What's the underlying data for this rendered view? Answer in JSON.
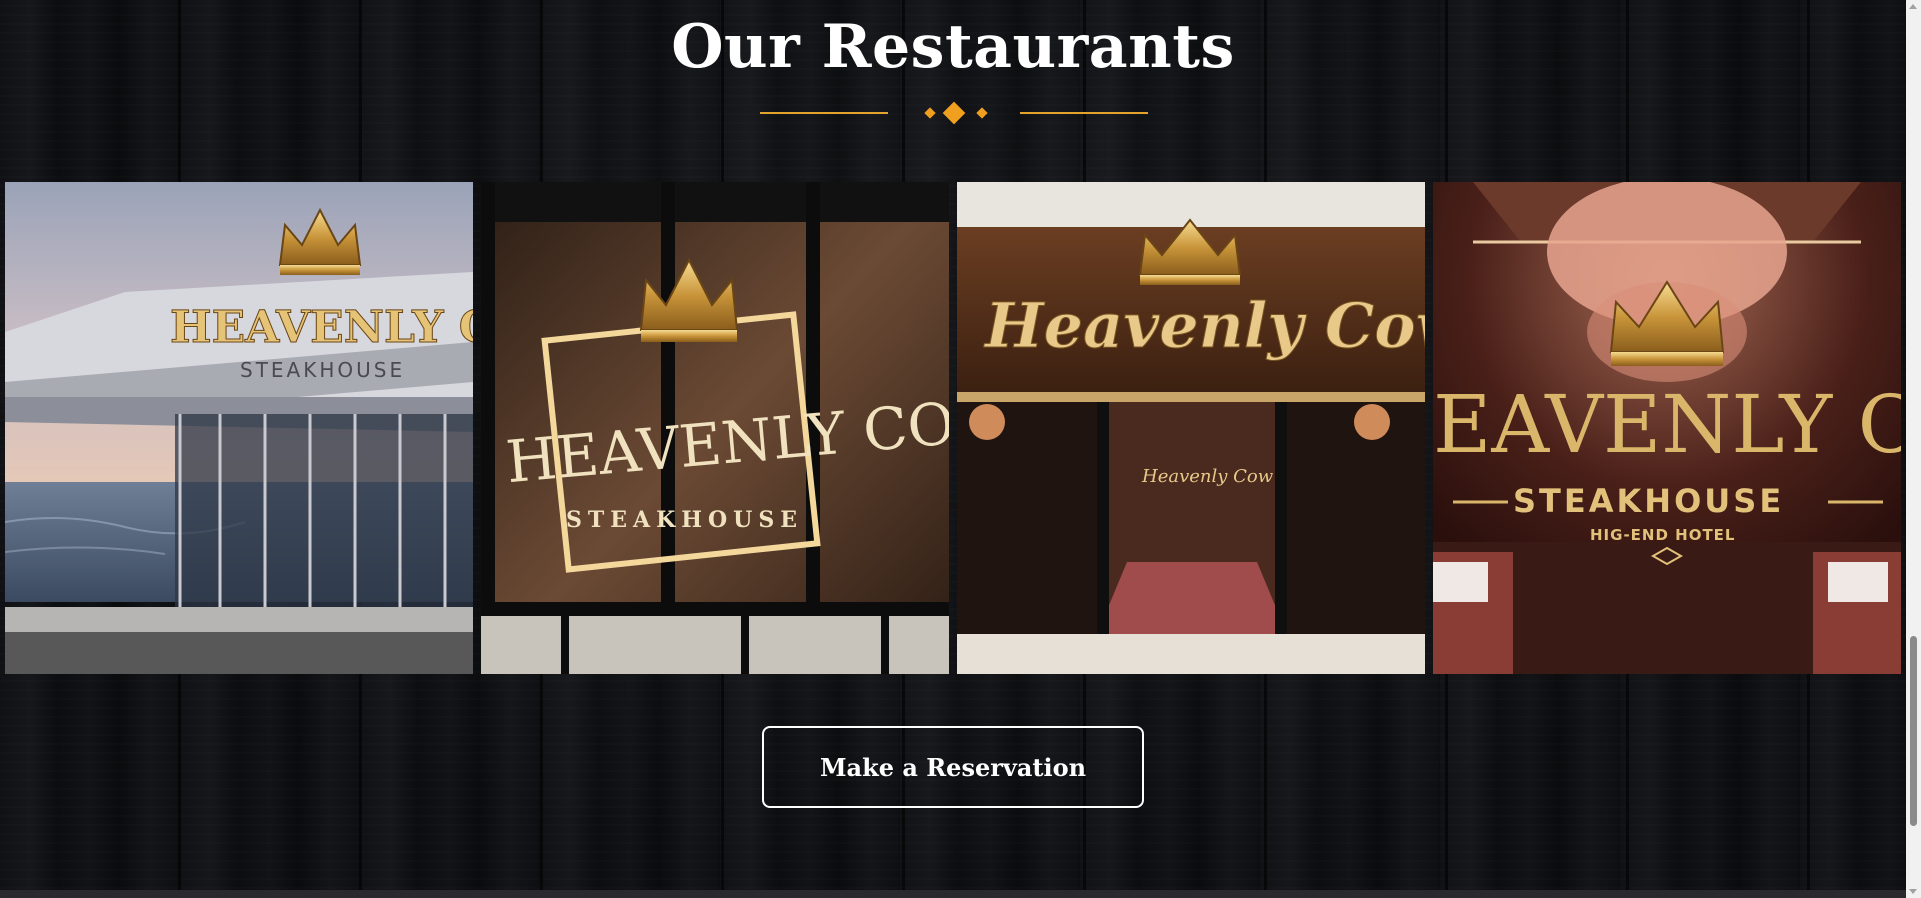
{
  "section": {
    "title": "Our Restaurants",
    "accent_color": "#f0a01e"
  },
  "gallery": {
    "images": [
      {
        "alt": "Heavenly Cow Steakhouse oceanfront exterior",
        "sign_main": "HEAVENLY CO",
        "sign_sub": "STEAKHOUSE"
      },
      {
        "alt": "Heavenly Cow Steakhouse glass storefront",
        "sign_main": "HEAVENLY COW",
        "sign_sub": "STEAKHOUSE"
      },
      {
        "alt": "Heavenly Cow restaurant entrance",
        "sign_main": "Heavenly Cow",
        "sign_sub": "Heavenly Cow"
      },
      {
        "alt": "Heavenly Cow Steakhouse hotel dining room",
        "sign_main": "EAVENLY CO",
        "sign_sub": "STEAKHOUSE",
        "sign_note": "HIG-END HOTEL"
      }
    ]
  },
  "cta": {
    "label": "Make a Reservation"
  }
}
